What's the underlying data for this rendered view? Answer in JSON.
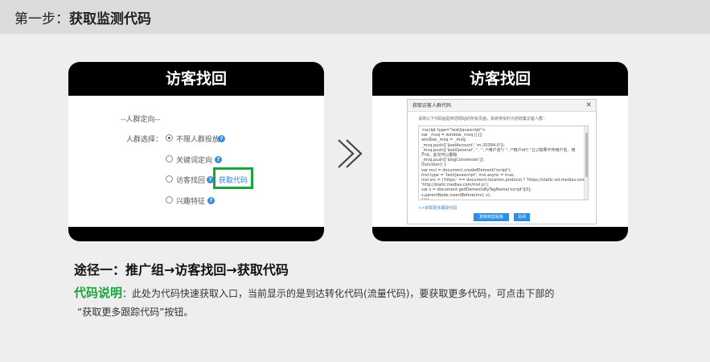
{
  "header": {
    "step_prefix": "第一步：",
    "step_title": "获取监测代码"
  },
  "left_panel": {
    "title": "访客找回",
    "section_label": "--人群定向--",
    "field_label": "人群选择：",
    "options": [
      {
        "label": "不限人群投放",
        "selected": true
      },
      {
        "label": "关键词定向",
        "selected": false
      },
      {
        "label": "访客找回",
        "selected": false
      },
      {
        "label": "兴趣特征",
        "selected": false
      }
    ],
    "get_code_link": "获取代码",
    "help_icon": "question-icon"
  },
  "right_panel": {
    "title": "访客找回",
    "dialog_title": "获取访客人群代码",
    "close_symbol": "✕",
    "info": "请将以下代码粘贴到您网站的所有页面，系统将实时为您收集访客人群：",
    "code_lines": [
      "<script type=\"text/javascript\">",
      "var _mvq = window._mvq || [];",
      "window._mvq = _mvq;",
      "_mvq.push(['$setAccount', 'm-20394-0']);",
      "_mvq.push(['$setGeneral', '', '', /*用户名*/ '', /*用户id*/ '']);//如果不传用户名、用户id，此句可以删除",
      "_mvq.push(['$logConversion']);",
      "(function() {",
      "var mvl = document.createElement('script');",
      "mvl.type = 'text/javascript'; mvl.async = true;",
      "mvl.src = ('https:' == document.location.protocol ? 'https://static-ssl.mediav.com/mvl.js' :",
      "'http://static.mediav.com/mvl.js');",
      "var s = document.getElementsByTagName('script')[0];",
      "s.parentNode.insertBefore(mvl, s);",
      "})();"
    ],
    "more_link": ">>获取更多跟踪代码",
    "copy_button": "复制到剪贴板",
    "close_button": "关闭"
  },
  "arrow_icon": "chevron-right-icon",
  "route": "途径一：推广组→访客找回→获取代码",
  "description": {
    "label": "代码说明",
    "text1": "：此处为代码快速获取入口，当前显示的是到达转化代码(流量代码)，要获取更多代码，可点击下部的",
    "text2": "“获取更多跟踪代码”按钮。"
  },
  "colors": {
    "accent_green": "#1aa53c",
    "link_blue": "#3a7fd0",
    "button_blue": "#2c8ee0"
  }
}
